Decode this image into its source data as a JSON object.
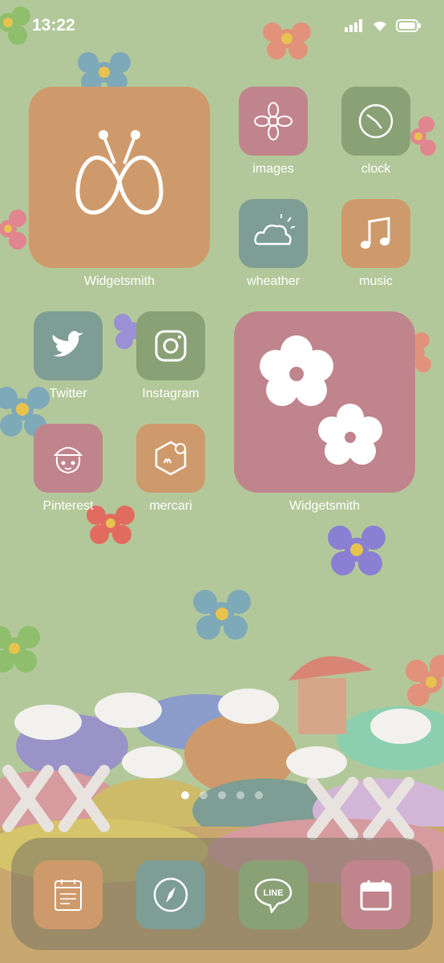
{
  "status_bar": {
    "time": "13:22"
  },
  "home": {
    "widget_large": {
      "label": "Widgetsmith",
      "color": "#cf9a6b"
    },
    "widget_flowers": {
      "label": "Widgetsmith",
      "color": "#c0848d"
    },
    "apps": [
      {
        "label": "images",
        "color": "#c0848d",
        "icon": "flower-icon"
      },
      {
        "label": "clock",
        "color": "#8aa176",
        "icon": "clock-icon"
      },
      {
        "label": "wheather",
        "color": "#7e9d94",
        "icon": "cloud-sun-icon"
      },
      {
        "label": "music",
        "color": "#cf9a6b",
        "icon": "music-note-icon"
      },
      {
        "label": "Twitter",
        "color": "#7e9d94",
        "icon": "twitter-bird-icon"
      },
      {
        "label": "Instagram",
        "color": "#8aa176",
        "icon": "instagram-camera-icon"
      },
      {
        "label": "Pinterest",
        "color": "#c0848d",
        "icon": "girl-face-icon"
      },
      {
        "label": "mercari",
        "color": "#cf9a6b",
        "icon": "mercari-box-icon"
      }
    ]
  },
  "pager": {
    "count": 5,
    "active": 1
  },
  "dock": {
    "apps": [
      {
        "name": "calendar-notes",
        "color": "#cf9a6b",
        "icon": "calendar-notes-icon"
      },
      {
        "name": "safari",
        "color": "#7e9d94",
        "icon": "compass-icon"
      },
      {
        "name": "line",
        "color": "#8aa176",
        "icon": "line-bubble-icon",
        "text": "LINE"
      },
      {
        "name": "calendar",
        "color": "#c0848d",
        "icon": "calendar-icon"
      }
    ]
  }
}
